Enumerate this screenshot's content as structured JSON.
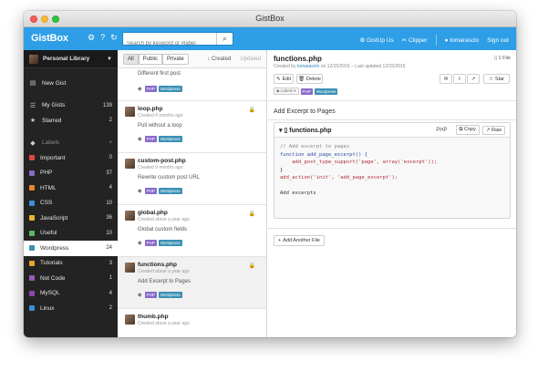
{
  "window": {
    "title": "GistBox"
  },
  "topbar": {
    "logo": "GistBox",
    "search_placeholder": "Search by keyword or #label",
    "gistup": "GistUp Us",
    "clipper": "Clipper",
    "user": "tomarasclo",
    "signout": "Sign out",
    "colors": {
      "accent": "#2e9fe6"
    }
  },
  "sidebar": {
    "library": "Personal Library",
    "new_gist": "New Gist",
    "my_gists": {
      "label": "My Gists",
      "count": "139"
    },
    "starred": {
      "label": "Starred",
      "count": "2"
    },
    "labels_head": "Labels",
    "labels": [
      {
        "label": "Important",
        "count": "0",
        "color": "#e0463a"
      },
      {
        "label": "PHP",
        "count": "37",
        "color": "#8a6ac8"
      },
      {
        "label": "HTML",
        "count": "4",
        "color": "#e8852a"
      },
      {
        "label": "CSS",
        "count": "10",
        "color": "#3b8fd9"
      },
      {
        "label": "JavaScript",
        "count": "36",
        "color": "#e8b52a"
      },
      {
        "label": "Useful",
        "count": "10",
        "color": "#5cb85c"
      },
      {
        "label": "Wordpress",
        "count": "24",
        "color": "#3b8fb5"
      },
      {
        "label": "Tutorials",
        "count": "3",
        "color": "#e8a12a"
      },
      {
        "label": "Not Code",
        "count": "1",
        "color": "#9b59b6"
      },
      {
        "label": "MySQL",
        "count": "4",
        "color": "#8e44ad"
      },
      {
        "label": "Linux",
        "count": "2",
        "color": "#3b8fd9"
      }
    ]
  },
  "list": {
    "tabs": [
      "All",
      "Public",
      "Private"
    ],
    "sort_created": "Created",
    "sort_updated": "Updated",
    "first_desc": "Different first post",
    "first_tags": [
      "PHP",
      "Wordpress"
    ],
    "items": [
      {
        "title": "loop.php",
        "date": "Created 4 months ago",
        "desc": "Pull without a loop",
        "tags": [
          "PHP",
          "Wordpress"
        ]
      },
      {
        "title": "custom-post.php",
        "date": "Created 9 months ago",
        "desc": "Rewrite custom post URL",
        "tags": [
          "PHP",
          "Wordpress"
        ]
      },
      {
        "title": "global.php",
        "date": "Created about a year ago",
        "desc": "Global custom fields",
        "tags": [
          "PHP",
          "Wordpress"
        ]
      },
      {
        "title": "functions.php",
        "date": "Created about a year ago",
        "desc": "Add Excerpt to Pages",
        "tags": [
          "PHP",
          "Wordpress"
        ]
      },
      {
        "title": "thumb.php",
        "date": "Created about a year ago",
        "desc": "",
        "tags": []
      }
    ]
  },
  "detail": {
    "title": "functions.php",
    "meta_created": "Created by",
    "meta_user": "tomarasclo",
    "meta_rest": "on 12/15/2015 – Last updated 12/15/2015",
    "files_count": "1 File",
    "edit": "Edit",
    "delete": "Delete",
    "star": "Star",
    "labels_btn": "Labels",
    "tags": [
      "PHP",
      "Wordpress"
    ],
    "description": "Add Excerpt to Pages",
    "file_name": "functions.php",
    "file_lang": "PHP",
    "copy": "Copy",
    "raw": "Raw",
    "code": [
      "// Add excerpt to pages",
      "function add_page_excerpt() {",
      "    add_post_type_support('page', array('excerpt'));",
      "}",
      "add_action('init', 'add_page_excerpt');",
      "",
      "Add excerpts"
    ],
    "add_file": "Add Another File"
  }
}
